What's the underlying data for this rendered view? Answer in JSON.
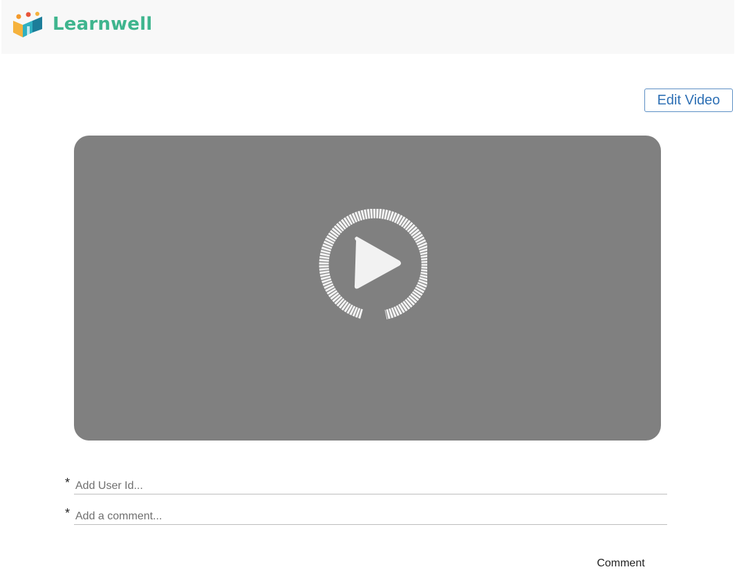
{
  "header": {
    "brand": "Learnwell",
    "logo_icon": "learnwell-logo-icon"
  },
  "toolbar": {
    "edit_label": "Edit Video"
  },
  "video": {
    "play_icon": "play-circle-icon"
  },
  "form": {
    "user_id": {
      "required_marker": "*",
      "placeholder": "Add User Id...",
      "value": ""
    },
    "comment": {
      "required_marker": "*",
      "placeholder": "Add a comment...",
      "value": ""
    },
    "submit_label": "Comment"
  },
  "colors": {
    "brand": "#3fb58e",
    "header_bg": "#f8f8f8",
    "video_bg": "#808080",
    "button_border": "#5b8ec4",
    "button_text": "#2d6fb4"
  }
}
